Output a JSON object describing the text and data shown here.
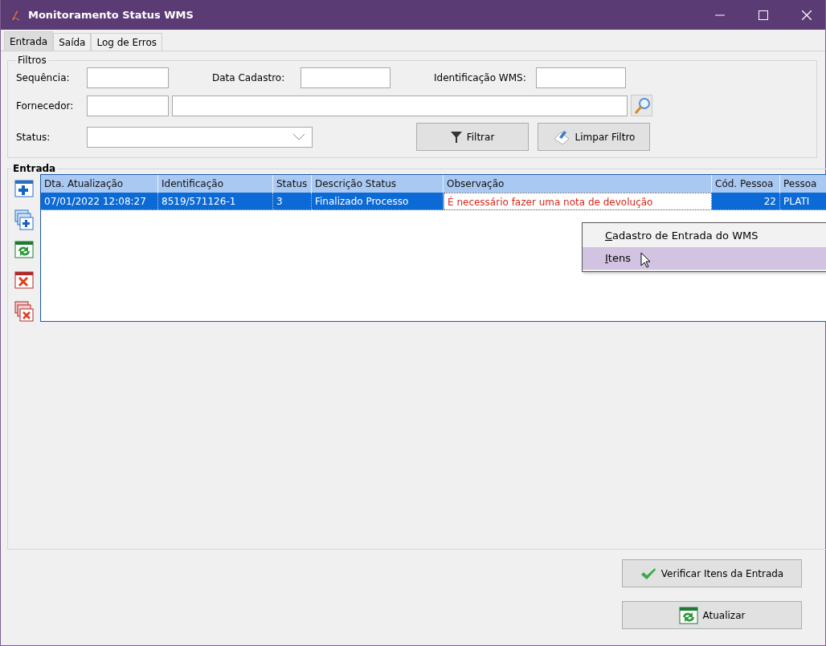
{
  "window": {
    "title": "Monitoramento Status WMS"
  },
  "tabs": [
    {
      "label": "Entrada",
      "selected": true
    },
    {
      "label": "Saída",
      "selected": false
    },
    {
      "label": "Log de Erros",
      "selected": false
    }
  ],
  "filters": {
    "title": "Filtros",
    "sequencia_label": "Sequência:",
    "data_cadastro_label": "Data Cadastro:",
    "identificacao_label": "Identificação WMS:",
    "fornecedor_label": "Fornecedor:",
    "status_label": "Status:",
    "filter_button": "Filtrar",
    "clear_button": "Limpar Filtro"
  },
  "entrada": {
    "title": "Entrada",
    "columns": [
      "Dta. Atualização",
      "Identificação",
      "Status",
      "Descrição Status",
      "Observação",
      "Cód. Pessoa",
      "Pessoa"
    ],
    "rows": [
      {
        "selected": true,
        "cells": [
          {
            "text": "07/01/2022 12:08:27",
            "focused": false
          },
          {
            "text": "8519/571126-1",
            "focused": false
          },
          {
            "text": "3",
            "focused": false
          },
          {
            "text": "Finalizado Processo",
            "focused": false
          },
          {
            "text": "É necessário fazer uma nota de devolução",
            "focused": true
          },
          {
            "text": "22",
            "focused": false
          },
          {
            "text": "PLATI",
            "focused": false
          }
        ]
      }
    ]
  },
  "context_menu": [
    {
      "label": "Cadastro de Entrada do WMS",
      "selected": false
    },
    {
      "label": "Itens",
      "selected": true
    }
  ],
  "buttons": [
    {
      "label": "Verificar Itens da Entrada",
      "kind": "check"
    },
    {
      "label": "Atualizar",
      "kind": "refresh"
    }
  ]
}
